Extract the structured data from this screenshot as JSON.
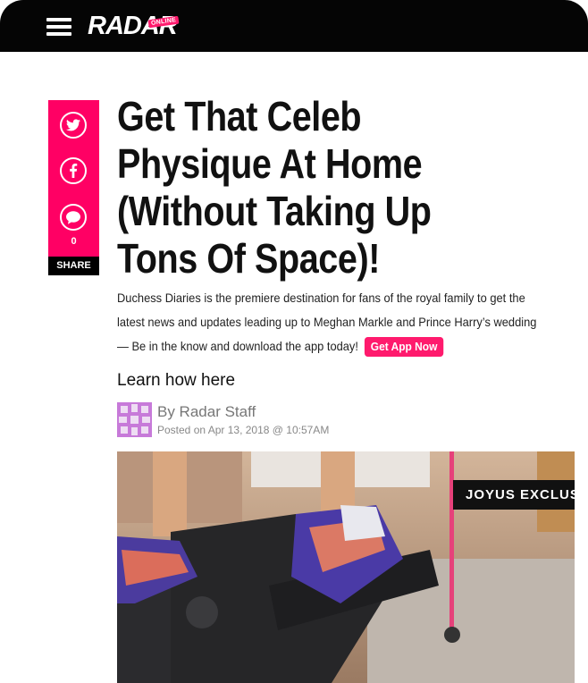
{
  "header": {
    "logo_text": "RADAR",
    "logo_badge": "ONLINE"
  },
  "share": {
    "count": "0",
    "label": "SHARE"
  },
  "article": {
    "title": "Get That Celeb Physique At Home (Without Taking Up Tons Of Space)!",
    "promo_text": "Duchess Diaries is the premiere destination for fans of the royal family to get the latest news and updates leading up to Meghan Markle and Prince Harry’s wedding — Be in the know and download the app today!",
    "app_button": "Get App Now",
    "learn_text": "Learn how here",
    "byline": "By Radar Staff",
    "dateline": "Posted on Apr 13, 2018 @ 10:57AM",
    "image_tag": "JOYUS EXCLUSIVE"
  },
  "colors": {
    "brand_pink": "#ff0064",
    "header_bg": "#050505"
  }
}
